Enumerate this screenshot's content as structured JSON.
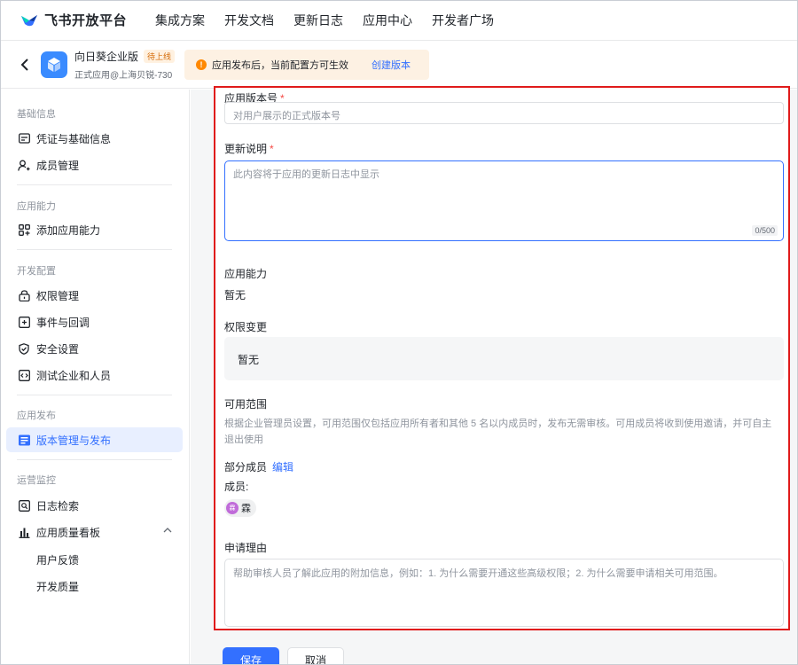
{
  "topnav": {
    "logo_text": "飞书开放平台",
    "items": [
      "集成方案",
      "开发文档",
      "更新日志",
      "应用中心",
      "开发者广场"
    ]
  },
  "app": {
    "name": "向日葵企业版",
    "badge": "待上线",
    "subtitle": "正式应用@上海贝锐-730"
  },
  "notice": {
    "text": "应用发布后，当前配置方可生效",
    "link": "创建版本"
  },
  "sidebar": {
    "sections": [
      {
        "title": "基础信息",
        "items": [
          "凭证与基础信息",
          "成员管理"
        ]
      },
      {
        "title": "应用能力",
        "items": [
          "添加应用能力"
        ]
      },
      {
        "title": "开发配置",
        "items": [
          "权限管理",
          "事件与回调",
          "安全设置",
          "测试企业和人员"
        ]
      },
      {
        "title": "应用发布",
        "items": [
          "版本管理与发布"
        ]
      },
      {
        "title": "运营监控",
        "items": [
          "日志检索",
          "应用质量看板"
        ]
      }
    ],
    "subitems": [
      "用户反馈",
      "开发质量"
    ]
  },
  "form": {
    "version_label": "应用版本号",
    "version_placeholder": "对用户展示的正式版本号",
    "notes_label": "更新说明",
    "notes_placeholder": "此内容将于应用的更新日志中显示",
    "notes_counter": "0/500",
    "capability_label": "应用能力",
    "capability_value": "暂无",
    "perm_label": "权限变更",
    "perm_value": "暂无",
    "scope_label": "可用范围",
    "scope_desc": "根据企业管理员设置，可用范围仅包括应用所有者和其他 5 名以内成员时，发布无需审核。可用成员将收到使用邀请，并可自主退出使用",
    "scope_value": "部分成员",
    "scope_edit": "编辑",
    "members_label": "成员:",
    "member_avatar": "霖",
    "member_name": "霖",
    "reason_label": "申请理由",
    "reason_placeholder": "帮助审核人员了解此应用的附加信息，例如：1. 为什么需要开通这些高级权限；2. 为什么需要申请相关可用范围。"
  },
  "buttons": {
    "save": "保存",
    "cancel": "取消"
  },
  "colors": {
    "accent": "#3370ff",
    "highlight_border": "#e01b1b",
    "warning": "#ff8800"
  }
}
